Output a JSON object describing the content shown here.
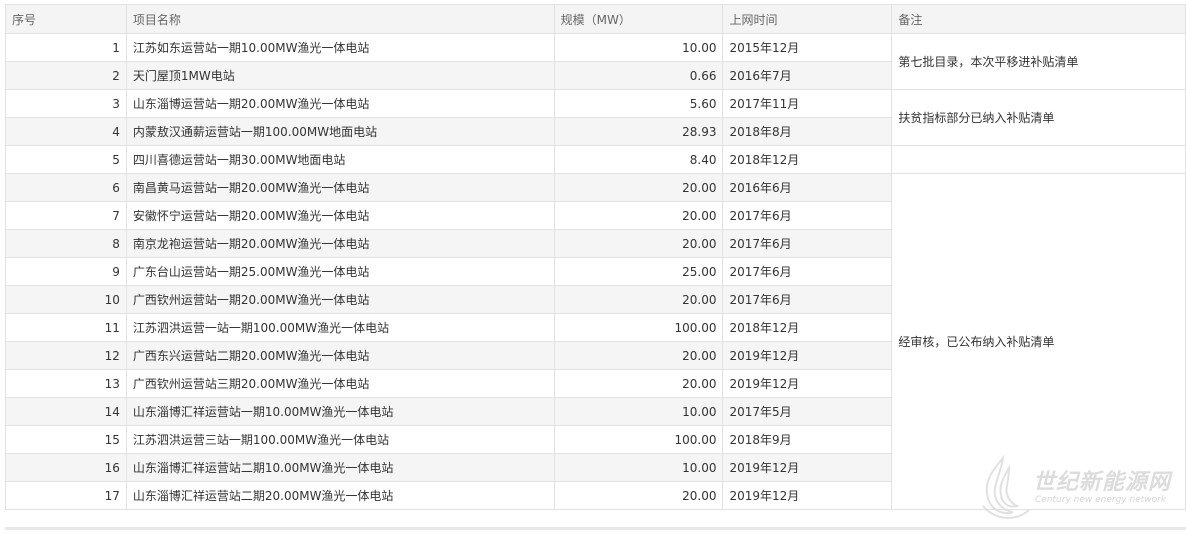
{
  "headers": [
    "序号",
    "项目名称",
    "规模（MW）",
    "上网时间",
    "备注"
  ],
  "rows": [
    {
      "no": "1",
      "name": "江苏如东运营站一期10.00MW渔光一体电站",
      "mw": "10.00",
      "date": "2015年12月"
    },
    {
      "no": "2",
      "name": "天门屋顶1MW电站",
      "mw": "0.66",
      "date": "2016年7月"
    },
    {
      "no": "3",
      "name": "山东淄博运营站一期20.00MW渔光一体电站",
      "mw": "5.60",
      "date": "2017年11月"
    },
    {
      "no": "4",
      "name": "内蒙敖汉通薪运营站一期100.00MW地面电站",
      "mw": "28.93",
      "date": "2018年8月"
    },
    {
      "no": "5",
      "name": "四川喜德运营站一期30.00MW地面电站",
      "mw": "8.40",
      "date": "2018年12月"
    },
    {
      "no": "6",
      "name": "南昌黄马运营站一期20.00MW渔光一体电站",
      "mw": "20.00",
      "date": "2016年6月"
    },
    {
      "no": "7",
      "name": "安徽怀宁运营站一期20.00MW渔光一体电站",
      "mw": "20.00",
      "date": "2017年6月"
    },
    {
      "no": "8",
      "name": "南京龙袍运营站一期20.00MW渔光一体电站",
      "mw": "20.00",
      "date": "2017年6月"
    },
    {
      "no": "9",
      "name": "广东台山运营站一期25.00MW渔光一体电站",
      "mw": "25.00",
      "date": "2017年6月"
    },
    {
      "no": "10",
      "name": "广西钦州运营站一期20.00MW渔光一体电站",
      "mw": "20.00",
      "date": "2017年6月"
    },
    {
      "no": "11",
      "name": "江苏泗洪运营一站一期100.00MW渔光一体电站",
      "mw": "100.00",
      "date": "2018年12月"
    },
    {
      "no": "12",
      "name": "广西东兴运营站二期20.00MW渔光一体电站",
      "mw": "20.00",
      "date": "2019年12月"
    },
    {
      "no": "13",
      "name": "广西钦州运营站三期20.00MW渔光一体电站",
      "mw": "20.00",
      "date": "2019年12月"
    },
    {
      "no": "14",
      "name": "山东淄博汇祥运营站一期10.00MW渔光一体电站",
      "mw": "10.00",
      "date": "2017年5月"
    },
    {
      "no": "15",
      "name": "江苏泗洪运营三站一期100.00MW渔光一体电站",
      "mw": "100.00",
      "date": "2018年9月"
    },
    {
      "no": "16",
      "name": "山东淄博汇祥运营站二期10.00MW渔光一体电站",
      "mw": "10.00",
      "date": "2019年12月"
    },
    {
      "no": "17",
      "name": "山东淄博汇祥运营站二期20.00MW渔光一体电站",
      "mw": "20.00",
      "date": "2019年12月"
    }
  ],
  "notes": {
    "n1": "第七批目录，本次平移进补贴清单",
    "n2": "扶贫指标部分已纳入补贴清单",
    "n3": "",
    "n4": "经审核，已公布纳入补贴清单"
  },
  "watermark": {
    "cn": "世纪新能源网",
    "en": "Century new energy network"
  }
}
